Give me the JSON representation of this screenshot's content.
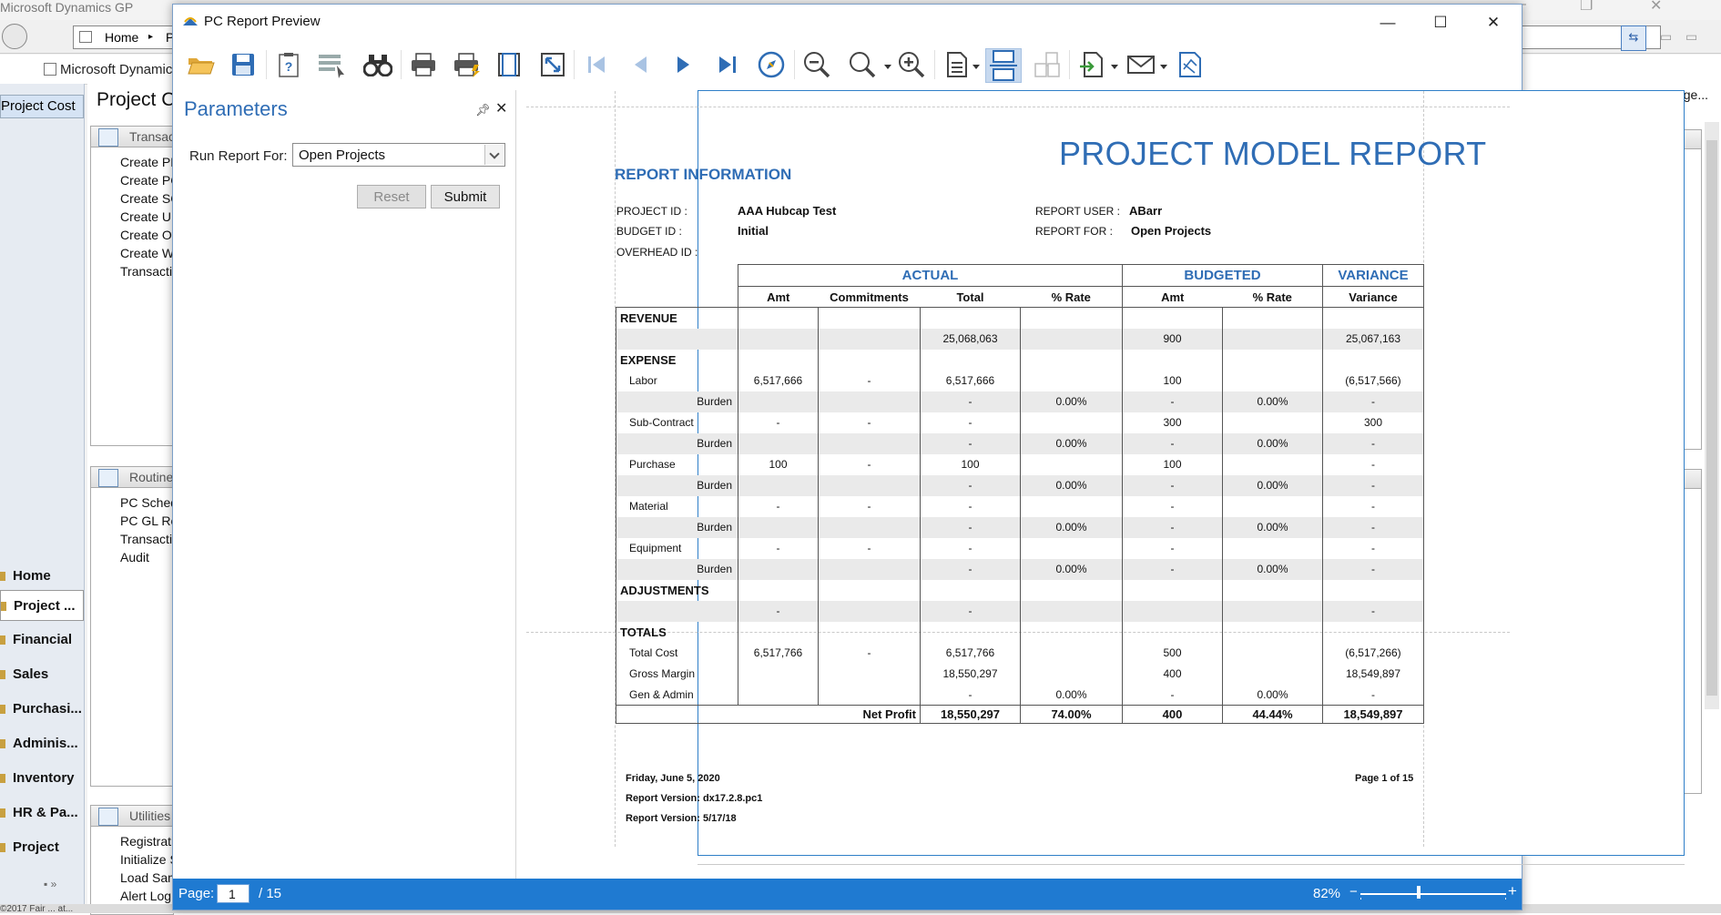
{
  "background_app": {
    "title": "Microsoft Dynamics GP",
    "nav": {
      "home_tab": "Home",
      "home_tab_tail": "P"
    },
    "breadcrumb": "Microsoft Dynamic",
    "left_selected": "Project Cost",
    "page_title": "Project C",
    "customize_link": "Customize this page...",
    "panels": [
      {
        "header": "Transac",
        "links": [
          "Create PM",
          "Create PC",
          "Create SC",
          "Create UP",
          "Create Ov",
          "Create WI",
          "Transactic"
        ]
      },
      {
        "header": "Routine",
        "links": [
          "PC Sched",
          "PC GL Re",
          "Transactic",
          "Audit"
        ]
      },
      {
        "header": "Utilities",
        "links": [
          "Registratic",
          "Initialize S",
          "Load Sam",
          "Alert Log"
        ]
      }
    ],
    "nav_buttons": [
      "Home",
      "Project ...",
      "Financial",
      "Sales",
      "Purchasi...",
      "Adminis...",
      "Inventory",
      "HR & Pa...",
      "Project"
    ],
    "status_text": "©2017 Fair ... at..."
  },
  "window": {
    "title": "PC Report Preview",
    "controls": {
      "minimize": "—",
      "maximize": "☐",
      "close": "✕"
    }
  },
  "parameters": {
    "title": "Parameters",
    "run_report_for_label": "Run Report For:",
    "run_report_for_value": "Open Projects",
    "reset_label": "Reset",
    "submit_label": "Submit"
  },
  "report": {
    "title": "PROJECT MODEL REPORT",
    "info_heading": "REPORT INFORMATION",
    "project_id_label": "PROJECT ID :",
    "project_id": "AAA Hubcap Test",
    "budget_id_label": "BUDGET ID :",
    "budget_id": "Initial",
    "overhead_id_label": "OVERHEAD ID :",
    "report_user_label": "REPORT USER :",
    "report_user": "ABarr",
    "report_for_label": "REPORT FOR :",
    "report_for": "Open Projects",
    "groups": {
      "actual": "ACTUAL",
      "budgeted": "BUDGETED",
      "variance": "VARIANCE"
    },
    "columns": [
      "Amt",
      "Commitments",
      "Total",
      "% Rate",
      "Amt",
      "% Rate",
      "Variance"
    ],
    "rows": [
      {
        "label": "REVENUE",
        "kind": "section",
        "cells": [
          "",
          "",
          "",
          "",
          "",
          "",
          ""
        ]
      },
      {
        "label": "",
        "kind": "value",
        "cells": [
          "",
          "",
          "25,068,063",
          "",
          "900",
          "",
          "25,067,163"
        ]
      },
      {
        "label": "EXPENSE",
        "kind": "section",
        "cells": [
          "",
          "",
          "",
          "",
          "",
          "",
          ""
        ]
      },
      {
        "label": "Labor",
        "kind": "item",
        "cells": [
          "6,517,666",
          "-",
          "6,517,666",
          "",
          "100",
          "",
          "(6,517,566)"
        ]
      },
      {
        "label": "Burden",
        "kind": "burden",
        "cells": [
          "",
          "",
          "-",
          "0.00%",
          "-",
          "0.00%",
          "-"
        ]
      },
      {
        "label": "Sub-Contract",
        "kind": "item",
        "cells": [
          "-",
          "-",
          "-",
          "",
          "300",
          "",
          "300"
        ]
      },
      {
        "label": "Burden",
        "kind": "burden",
        "cells": [
          "",
          "",
          "-",
          "0.00%",
          "-",
          "0.00%",
          "-"
        ]
      },
      {
        "label": "Purchase",
        "kind": "item",
        "cells": [
          "100",
          "-",
          "100",
          "",
          "100",
          "",
          "-"
        ]
      },
      {
        "label": "Burden",
        "kind": "burden",
        "cells": [
          "",
          "",
          "-",
          "0.00%",
          "-",
          "0.00%",
          "-"
        ]
      },
      {
        "label": "Material",
        "kind": "item",
        "cells": [
          "-",
          "-",
          "-",
          "",
          "-",
          "",
          "-"
        ]
      },
      {
        "label": "Burden",
        "kind": "burden",
        "cells": [
          "",
          "",
          "-",
          "0.00%",
          "-",
          "0.00%",
          "-"
        ]
      },
      {
        "label": "Equipment",
        "kind": "item",
        "cells": [
          "-",
          "-",
          "-",
          "",
          "-",
          "",
          "-"
        ]
      },
      {
        "label": "Burden",
        "kind": "burden",
        "cells": [
          "",
          "",
          "-",
          "0.00%",
          "-",
          "0.00%",
          "-"
        ]
      },
      {
        "label": "ADJUSTMENTS",
        "kind": "section",
        "cells": [
          "",
          "",
          "",
          "",
          "",
          "",
          ""
        ]
      },
      {
        "label": "",
        "kind": "value",
        "cells": [
          "-",
          "",
          "-",
          "",
          "",
          "",
          "-"
        ]
      },
      {
        "label": "TOTALS",
        "kind": "section",
        "cells": [
          "",
          "",
          "",
          "",
          "",
          "",
          ""
        ]
      },
      {
        "label": "Total Cost",
        "kind": "item",
        "cells": [
          "6,517,766",
          "-",
          "6,517,766",
          "",
          "500",
          "",
          "(6,517,266)"
        ]
      },
      {
        "label": "Gross Margin",
        "kind": "item",
        "cells": [
          "",
          "",
          "18,550,297",
          "",
          "400",
          "",
          "18,549,897"
        ]
      },
      {
        "label": "Gen & Admin",
        "kind": "item",
        "cells": [
          "",
          "",
          "-",
          "0.00%",
          "-",
          "0.00%",
          "-"
        ]
      }
    ],
    "net_profit": {
      "label": "Net Profit",
      "total": "18,550,297",
      "rate": "74.00%",
      "budget_amt": "400",
      "budget_rate": "44.44%",
      "variance": "18,549,897"
    },
    "footer": {
      "date": "Friday, June 5, 2020",
      "version": "Report Version: dx17.2.8.pc1",
      "version_date": "Report Version: 5/17/18",
      "page_of": "Page 1 of 15"
    }
  },
  "statusbar": {
    "page_label": "Page:",
    "page_current": "1",
    "page_total": "/ 15",
    "zoom": "82%",
    "zoom_level_percent": 82
  }
}
